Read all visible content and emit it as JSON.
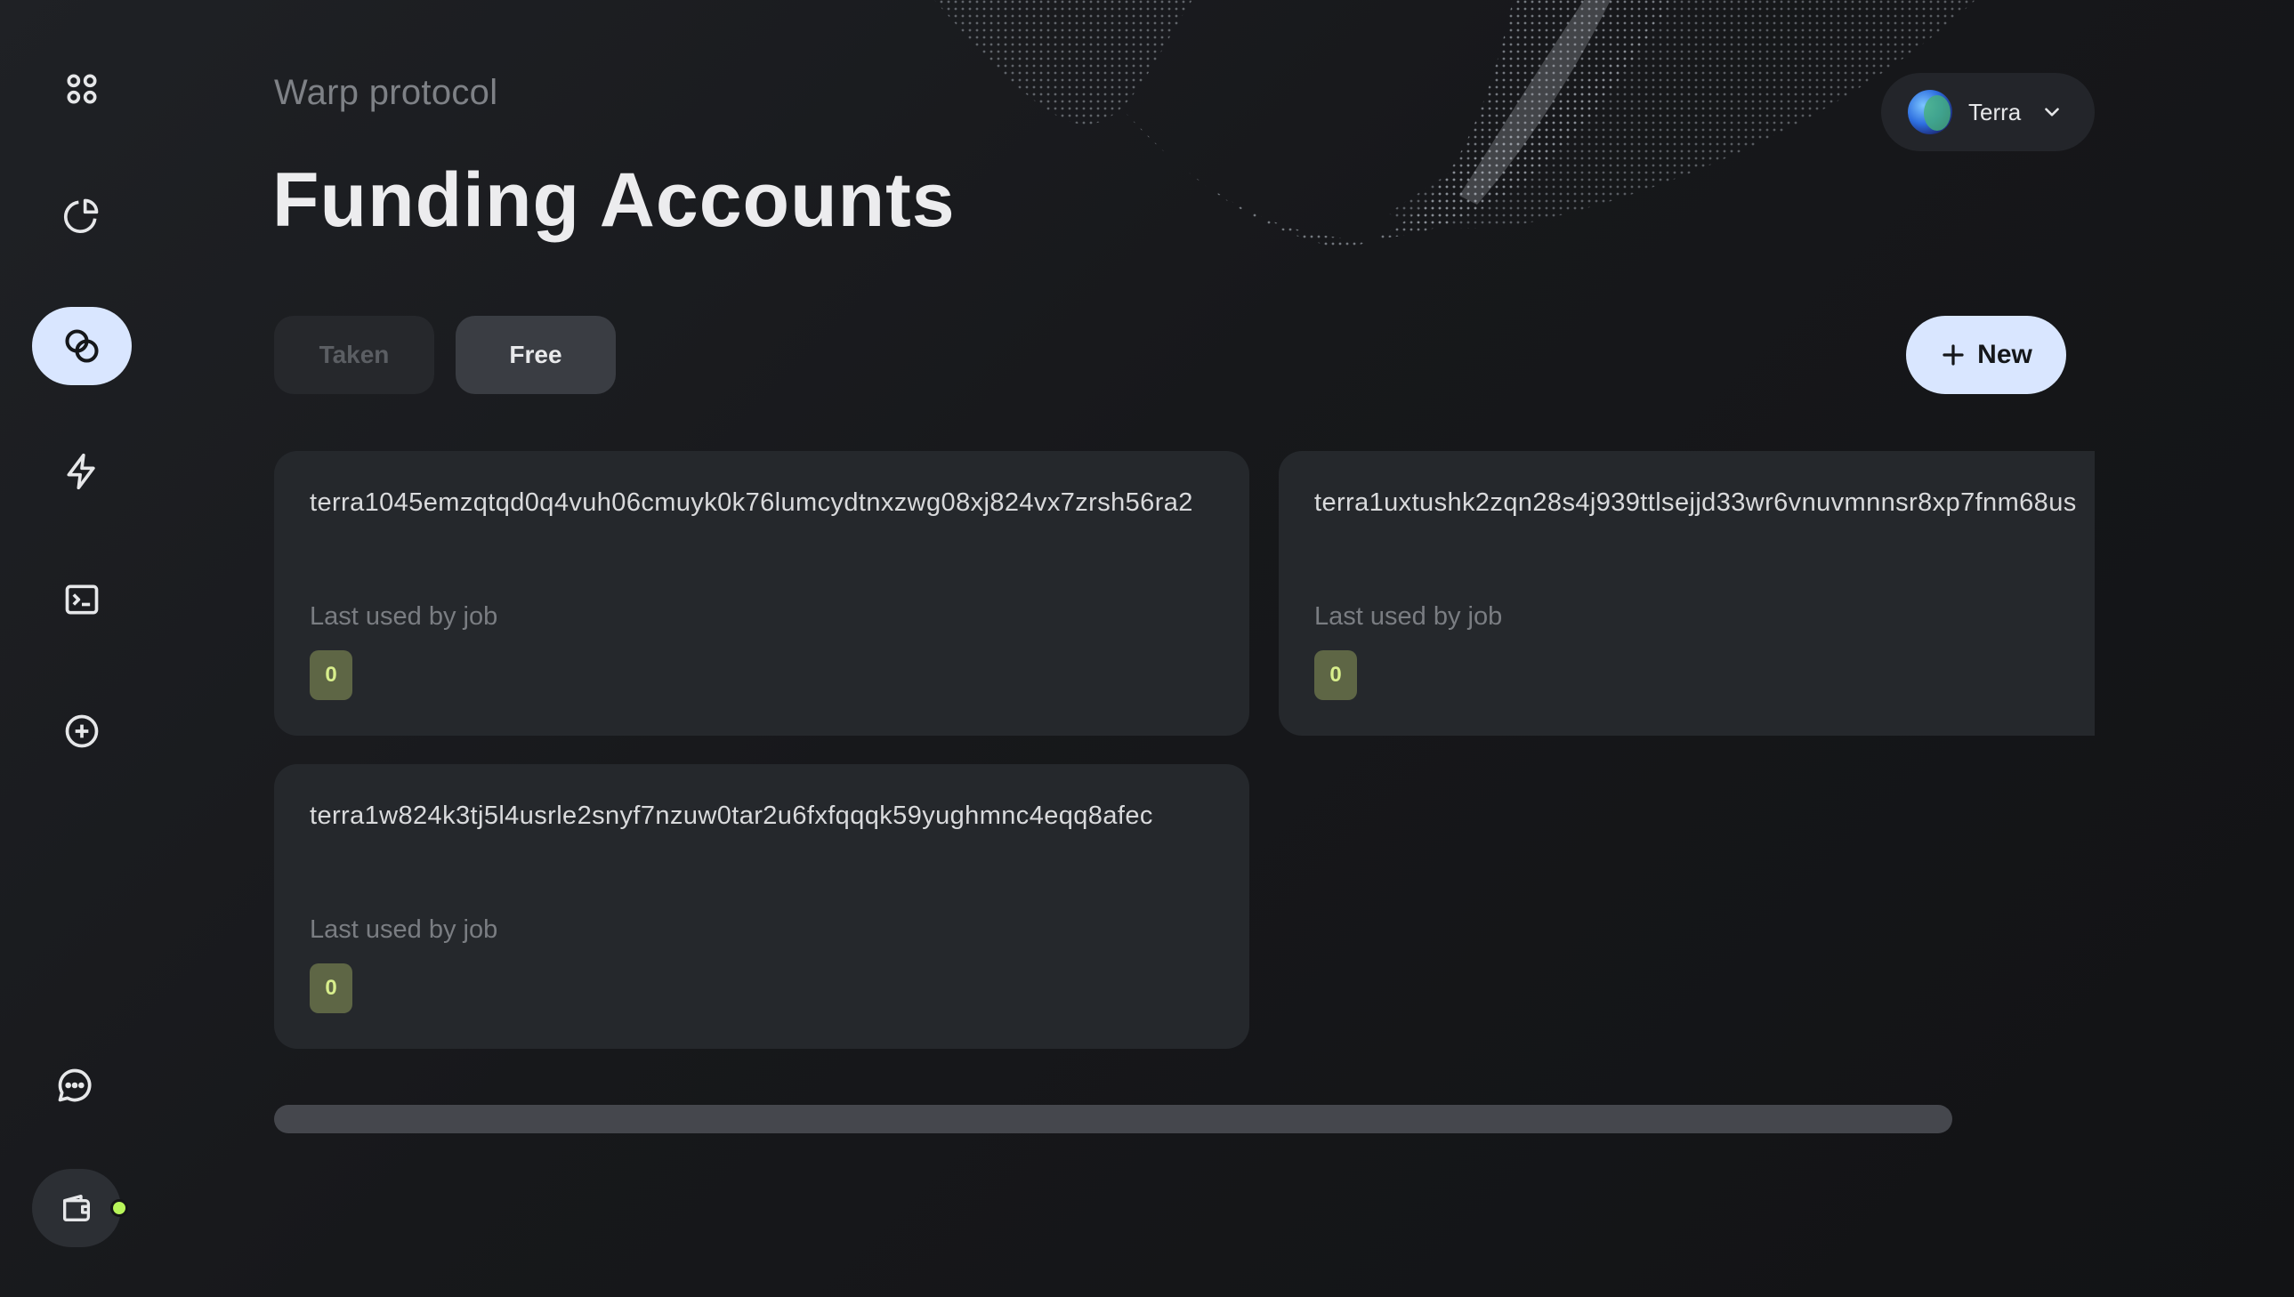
{
  "header": {
    "subtitle": "Warp protocol",
    "title": "Funding Accounts"
  },
  "network": {
    "label": "Terra"
  },
  "tabs": [
    {
      "label": "Taken",
      "active": false
    },
    {
      "label": "Free",
      "active": true
    }
  ],
  "new_button": {
    "label": "New"
  },
  "sidebar": {
    "items": [
      {
        "icon": "grid-icon"
      },
      {
        "icon": "pie-chart-icon"
      },
      {
        "icon": "circles-icon",
        "active": true
      },
      {
        "icon": "lightning-icon"
      },
      {
        "icon": "terminal-icon"
      },
      {
        "icon": "plus-circle-icon"
      },
      {
        "icon": "chat-icon"
      },
      {
        "icon": "wallet-icon"
      }
    ],
    "accent": "#d9e6ff",
    "status_dot": "#b8f55a"
  },
  "accounts": [
    {
      "address": "terra1045emzqtqd0q4vuh06cmuyk0k76lumcydtnxzwg08xj824vx7zrsh56ra2",
      "last_used_label": "Last used by job",
      "job": "0"
    },
    {
      "address": "terra1uxtushk2zqn28s4j939ttlsejjd33wr6vnuvmnnsr8xp7fnm68us",
      "last_used_label": "Last used by job",
      "job": "0"
    },
    {
      "address": "terra1w824k3tj5l4usrle2snyf7nzuw0tar2u6fxfqqqk59yughmnc4eqq8afec",
      "last_used_label": "Last used by job",
      "job": "0"
    }
  ]
}
